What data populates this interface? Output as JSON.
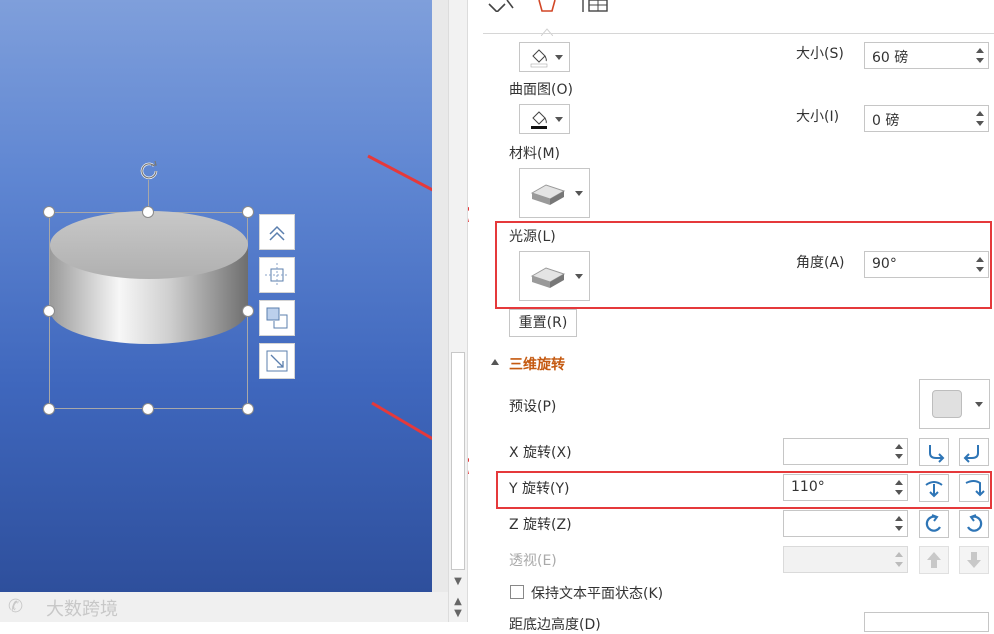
{
  "panel": {
    "top_controls": {
      "size1_label": "大小(S)",
      "size1_value": "60 磅",
      "contour_label": "曲面图(O)",
      "size2_label": "大小(I)",
      "size2_value": "0 磅",
      "material_label": "材料(M)",
      "light_label": "光源(L)",
      "angle_label": "角度(A)",
      "angle_value": "90°",
      "reset_label": "重置(R)"
    },
    "rotation_section": {
      "title": "三维旋转",
      "preset_label": "预设(P)",
      "x_label": "X 旋转(X)",
      "x_value": "",
      "y_label": "Y 旋转(Y)",
      "y_value": "110°",
      "z_label": "Z 旋转(Z)",
      "z_value": "",
      "perspective_label": "透视(E)",
      "perspective_value": "",
      "keep_text_flat_label": "保持文本平面状态(K)",
      "distance_label": "距底边高度(D)"
    }
  },
  "watermark": "大数跨境",
  "colors": {
    "accent_red": "#e5393b",
    "section_title": "#c55a11",
    "icon_blue": "#2e75b6"
  }
}
